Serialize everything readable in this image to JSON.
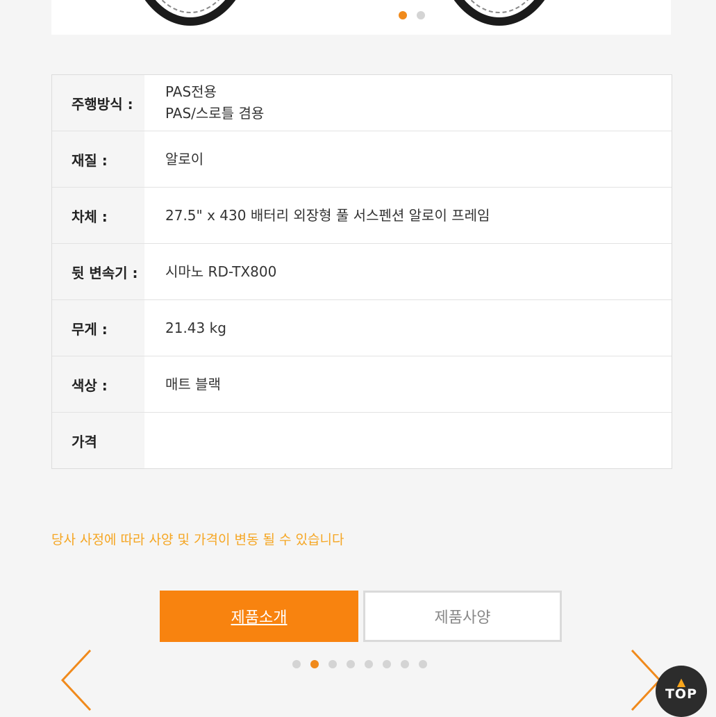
{
  "hero": {
    "slide_count": 2,
    "active_slide": 0
  },
  "specs": [
    {
      "label": "주행방식 :",
      "values": [
        "PAS전용",
        "PAS/스로틀 겸용"
      ]
    },
    {
      "label": "재질 :",
      "values": [
        "알로이"
      ]
    },
    {
      "label": "차체 :",
      "values": [
        "27.5\" x 430 배터리 외장형 풀 서스펜션 알로이 프레임"
      ]
    },
    {
      "label": "뒷 변속기 :",
      "values": [
        "시마노 RD-TX800"
      ]
    },
    {
      "label": "무게 :",
      "values": [
        "21.43 kg"
      ]
    },
    {
      "label": "색상 :",
      "values": [
        "매트 블랙"
      ]
    },
    {
      "label": "가격",
      "values": []
    }
  ],
  "notice": "당사 사정에 따라 사양 및 가격이 변동 될 수 있습니다",
  "tabs": {
    "intro_label": "제품소개",
    "spec_label": "제품사양"
  },
  "pager": {
    "count": 8,
    "active": 1
  },
  "top_button": {
    "label": "TOP",
    "icon": "caret-up-icon"
  },
  "colors": {
    "accent": "#f8830f",
    "notice": "#f5a623",
    "inactive_dot": "#d4d4d4"
  }
}
